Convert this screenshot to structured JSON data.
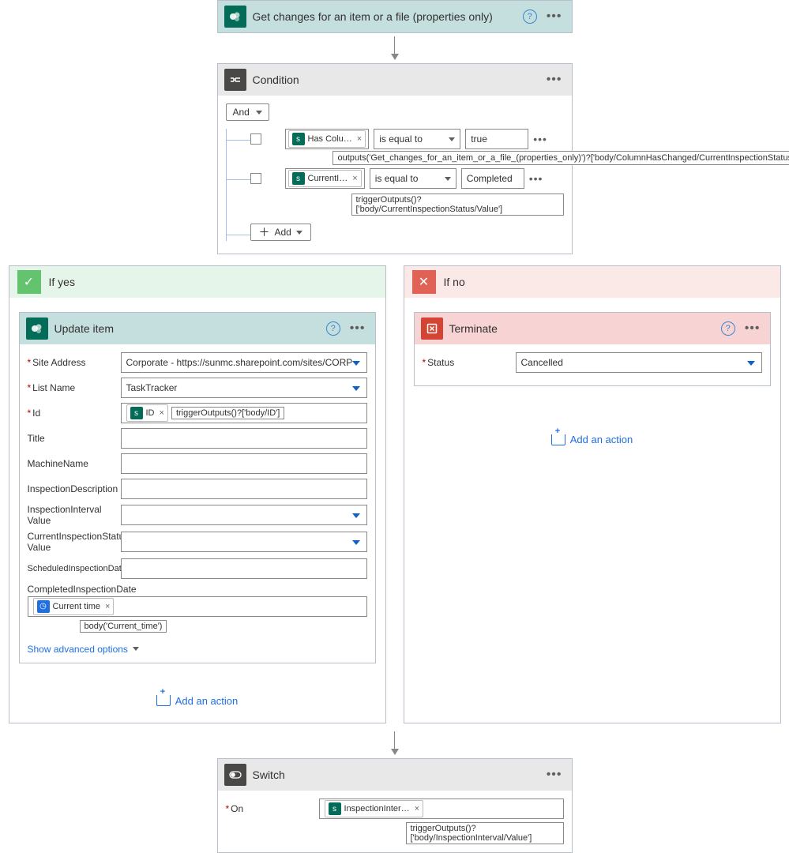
{
  "topStep": {
    "title": "Get changes for an item or a file (properties only)"
  },
  "condition": {
    "title": "Condition",
    "groupOperator": "And",
    "rows": [
      {
        "tokenLabel": "Has Colu…",
        "operator": "is equal to",
        "value": "true",
        "expr": "outputs('Get_changes_for_an_item_or_a_file_(properties_only)')?['body/ColumnHasChanged/CurrentInspectionStatus']"
      },
      {
        "tokenLabel": "CurrentI…",
        "operator": "is equal to",
        "value": "Completed",
        "expr": "triggerOutputs()?['body/CurrentInspectionStatus/Value']"
      }
    ],
    "addLabel": "Add"
  },
  "yes": {
    "branch": "If yes",
    "card": {
      "title": "Update item",
      "site": {
        "label": "Site Address",
        "value": "Corporate - https://sunmc.sharepoint.com/sites/CORP"
      },
      "list": {
        "label": "List Name",
        "value": "TaskTracker"
      },
      "id": {
        "label": "Id",
        "tokenLabel": "ID",
        "expr": "triggerOutputs()?['body/ID']"
      },
      "fields": {
        "title": "Title",
        "machine": "MachineName",
        "desc": "InspectionDescription",
        "ival": "InspectionInterval Value",
        "status": "CurrentInspectionStatus Value",
        "sched": "ScheduledInspectionDate",
        "compLabel": "CompletedInspectionDate",
        "compTokenLabel": "Current time",
        "compExpr": "body('Current_time')"
      },
      "showAdvanced": "Show advanced options"
    },
    "addAction": "Add an action"
  },
  "no": {
    "branch": "If no",
    "card": {
      "title": "Terminate",
      "statusLabel": "Status",
      "statusValue": "Cancelled"
    },
    "addAction": "Add an action"
  },
  "switch": {
    "title": "Switch",
    "onLabel": "On",
    "tokenLabel": "InspectionInter…",
    "expr": "triggerOutputs()?['body/InspectionInterval/Value']"
  }
}
